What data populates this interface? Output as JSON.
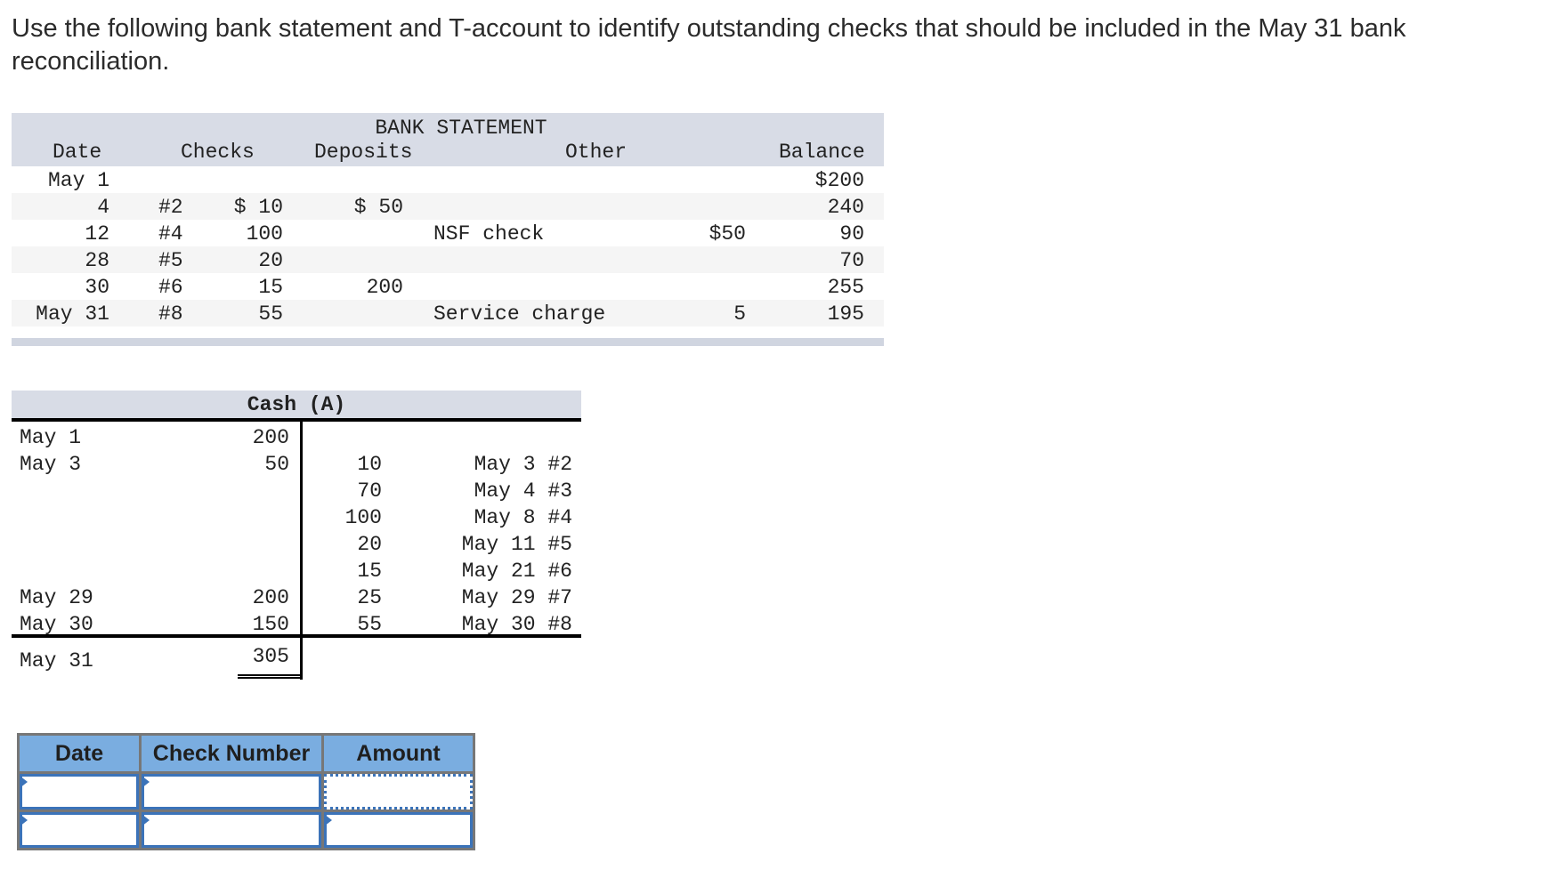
{
  "prompt": "Use the following bank statement and T-account to identify outstanding checks that should be included in the May 31 bank reconciliation.",
  "bank_statement": {
    "title": "BANK STATEMENT",
    "headers": {
      "date": "Date",
      "checks": "Checks",
      "deposits": "Deposits",
      "other": "Other",
      "balance": "Balance"
    },
    "rows": [
      {
        "date": "May 1",
        "check_no": "",
        "check_amt": "",
        "deposit": "",
        "other_desc": "",
        "other_amt": "",
        "balance": "$200"
      },
      {
        "date": "4",
        "check_no": "#2",
        "check_amt": "$ 10",
        "deposit": "$ 50",
        "other_desc": "",
        "other_amt": "",
        "balance": "240"
      },
      {
        "date": "12",
        "check_no": "#4",
        "check_amt": "100",
        "deposit": "",
        "other_desc": "NSF check",
        "other_amt": "$50",
        "balance": "90"
      },
      {
        "date": "28",
        "check_no": "#5",
        "check_amt": "20",
        "deposit": "",
        "other_desc": "",
        "other_amt": "",
        "balance": "70"
      },
      {
        "date": "30",
        "check_no": "#6",
        "check_amt": "15",
        "deposit": "200",
        "other_desc": "",
        "other_amt": "",
        "balance": "255"
      },
      {
        "date": "May 31",
        "check_no": "#8",
        "check_amt": "55",
        "deposit": "",
        "other_desc": "Service charge",
        "other_amt": "5",
        "balance": "195"
      }
    ]
  },
  "t_account": {
    "title": "Cash (A)",
    "debits": [
      {
        "date": "May 1",
        "amount": "200"
      },
      {
        "date": "May 3",
        "amount": "50"
      },
      {
        "date": "May 29",
        "amount": "200"
      },
      {
        "date": "May 30",
        "amount": "150"
      }
    ],
    "credits": [
      {
        "amount": "10",
        "ref": "May 3 #2"
      },
      {
        "amount": "70",
        "ref": "May 4 #3"
      },
      {
        "amount": "100",
        "ref": "May 8 #4"
      },
      {
        "amount": "20",
        "ref": "May 11 #5"
      },
      {
        "amount": "15",
        "ref": "May 21 #6"
      },
      {
        "amount": "25",
        "ref": "May 29 #7"
      },
      {
        "amount": "55",
        "ref": "May 30 #8"
      }
    ],
    "ending": {
      "date": "May 31",
      "amount": "305"
    }
  },
  "answer_table": {
    "headers": {
      "date": "Date",
      "check_number": "Check Number",
      "amount": "Amount"
    },
    "rows": [
      {
        "date": "",
        "check_number": "",
        "amount": ""
      },
      {
        "date": "",
        "check_number": "",
        "amount": ""
      }
    ]
  }
}
